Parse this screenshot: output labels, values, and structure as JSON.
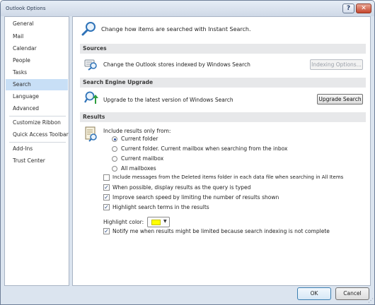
{
  "window": {
    "title": "Outlook Options"
  },
  "sidebar": {
    "items": [
      {
        "label": "General"
      },
      {
        "label": "Mail"
      },
      {
        "label": "Calendar"
      },
      {
        "label": "People"
      },
      {
        "label": "Tasks"
      },
      {
        "label": "Search",
        "selected": true
      },
      {
        "label": "Language"
      },
      {
        "label": "Advanced"
      },
      {
        "label": "Customize Ribbon"
      },
      {
        "label": "Quick Access Toolbar"
      },
      {
        "label": "Add-Ins"
      },
      {
        "label": "Trust Center"
      }
    ]
  },
  "content": {
    "intro": "Change how items are searched with Instant Search.",
    "sources": {
      "header": "Sources",
      "description": "Change the Outlook stores indexed by Windows Search",
      "button": "Indexing Options..."
    },
    "upgrade": {
      "header": "Search Engine Upgrade",
      "description": "Upgrade to the latest version of Windows Search",
      "button": "Upgrade Search"
    },
    "results": {
      "header": "Results",
      "include_label": "Include results only from:",
      "radios": [
        {
          "label": "Current folder",
          "selected": true
        },
        {
          "label": "Current folder. Current mailbox when searching from the inbox",
          "selected": false
        },
        {
          "label": "Current mailbox",
          "selected": false
        },
        {
          "label": "All mailboxes",
          "selected": false
        }
      ],
      "checkboxes": [
        {
          "label": "Include messages from the Deleted items folder in each data file when searching in All Items",
          "checked": false
        },
        {
          "label": "When possible, display results as the query is typed",
          "checked": true
        },
        {
          "label": "Improve search speed by limiting the number of results shown",
          "checked": true
        },
        {
          "label": "Highlight search terms in the results",
          "checked": true
        }
      ],
      "highlight_color_label": "Highlight color:",
      "highlight_color": "#ffff00",
      "notify": {
        "label": "Notify me when results might be limited because search indexing is not complete",
        "checked": true
      }
    }
  },
  "footer": {
    "ok": "OK",
    "cancel": "Cancel"
  }
}
